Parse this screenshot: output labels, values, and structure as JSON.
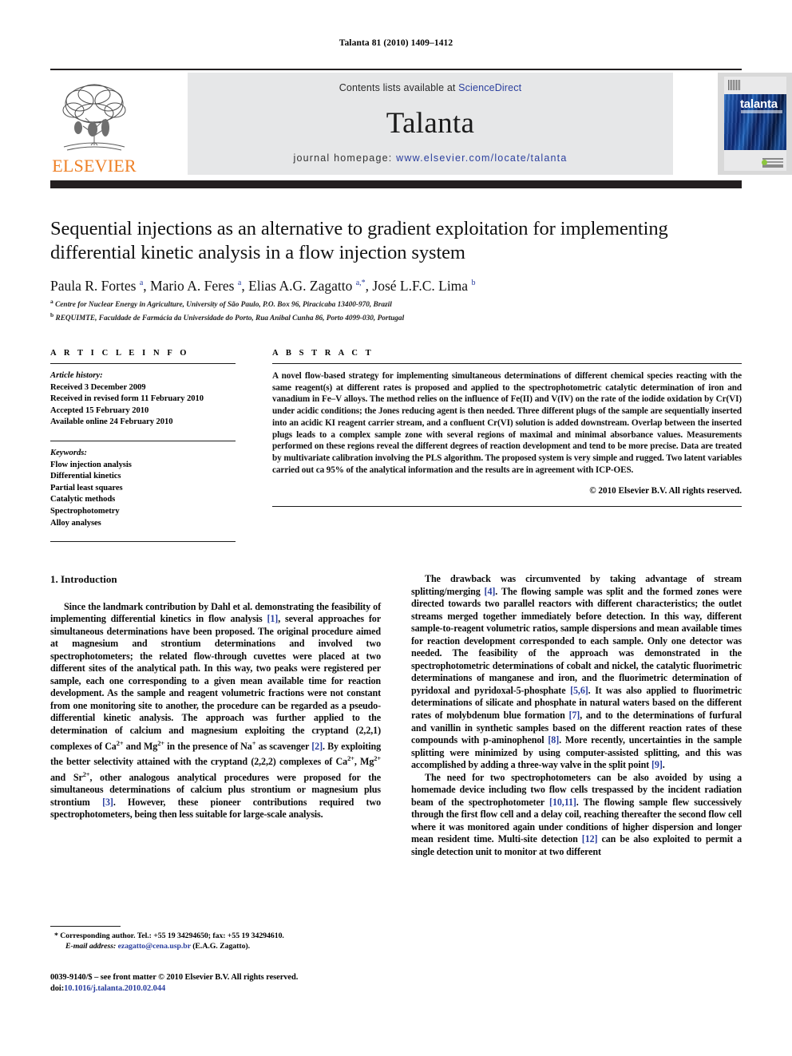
{
  "running_head": "Talanta 81 (2010) 1409–1412",
  "masthead": {
    "contents_prefix": "Contents lists available at ",
    "sciencedirect": "ScienceDirect",
    "journal_name": "Talanta",
    "homepage_prefix": "journal homepage:",
    "homepage_url": "www.elsevier.com/locate/talanta",
    "publisher_logo_text": "ELSEVIER",
    "cover_title": "talanta",
    "accent_orange": "#ee7f25",
    "link_blue": "#2b3f9e",
    "band_gray": "#e6e7e8",
    "rule_dark": "#231f20"
  },
  "article": {
    "title": "Sequential injections as an alternative to gradient exploitation for implementing differential kinetic analysis in a flow injection system",
    "authors_html": "Paula R. Fortes <sup>a</sup>, Mario A. Feres <sup>a</sup>, Elias A.G. Zagatto <sup>a,*</sup>, José L.F.C. Lima <sup>b</sup>",
    "affiliation_a": "Centre for Nuclear Energy in Agriculture, University of São Paulo, P.O. Box 96, Piracicaba 13400-970, Brazil",
    "affiliation_b": "REQUIMTE, Faculdade de Farmácia da Universidade do Porto, Rua Anibal Cunha 86, Porto 4099-030, Portugal"
  },
  "info": {
    "heading": "A R T I C L E   I N F O",
    "history_label": "Article history:",
    "history": [
      "Received 3 December 2009",
      "Received in revised form 11 February 2010",
      "Accepted 15 February 2010",
      "Available online 24 February 2010"
    ],
    "keywords_label": "Keywords:",
    "keywords": [
      "Flow injection analysis",
      "Differential kinetics",
      "Partial least squares",
      "Catalytic methods",
      "Spectrophotometry",
      "Alloy analyses"
    ]
  },
  "abstract": {
    "heading": "A B S T R A C T",
    "text": "A novel flow-based strategy for implementing simultaneous determinations of different chemical species reacting with the same reagent(s) at different rates is proposed and applied to the spectrophotometric catalytic determination of iron and vanadium in Fe–V alloys. The method relies on the influence of Fe(II) and V(IV) on the rate of the iodide oxidation by Cr(VI) under acidic conditions; the Jones reducing agent is then needed. Three different plugs of the sample are sequentially inserted into an acidic KI reagent carrier stream, and a confluent Cr(VI) solution is added downstream. Overlap between the inserted plugs leads to a complex sample zone with several regions of maximal and minimal absorbance values. Measurements performed on these regions reveal the different degrees of reaction development and tend to be more precise. Data are treated by multivariate calibration involving the PLS algorithm. The proposed system is very simple and rugged. Two latent variables carried out ca 95% of the analytical information and the results are in agreement with ICP-OES.",
    "copyright": "© 2010 Elsevier B.V. All rights reserved."
  },
  "body": {
    "section_heading": "1.  Introduction",
    "left_paragraphs_html": [
      "Since the landmark contribution by Dahl et al. demonstrating the feasibility of implementing differential kinetics in flow analysis <span class=\"ref\">[1]</span>, several approaches for simultaneous determinations have been proposed. The original procedure aimed at magnesium and strontium determinations and involved two spectrophotometers; the related flow-through cuvettes were placed at two different sites of the analytical path. In this way, two peaks were registered per sample, each one corresponding to a given mean available time for reaction development. As the sample and reagent volumetric fractions were not constant from one monitoring site to another, the procedure can be regarded as a pseudo-differential kinetic analysis. The approach was further applied to the determination of calcium and magnesium exploiting the cryptand (2,2,1) complexes of Ca<sup class=\"chg\">2+</sup> and Mg<sup class=\"chg\">2+</sup> in the presence of Na<sup class=\"chg\">+</sup> as scavenger <span class=\"ref\">[2]</span>. By exploiting the better selectivity attained with the cryptand (2,2,2) complexes of Ca<sup class=\"chg\">2+</sup>, Mg<sup class=\"chg\">2+</sup> and Sr<sup class=\"chg\">2+</sup>, other analogous analytical procedures were proposed for the simultaneous determinations of calcium plus strontium or magnesium plus strontium <span class=\"ref\">[3]</span>. However, these pioneer contributions required two spectrophotometers, being then less suitable for large-scale analysis."
    ],
    "right_paragraphs_html": [
      "The drawback was circumvented by taking advantage of stream splitting/merging <span class=\"ref\">[4]</span>. The flowing sample was split and the formed zones were directed towards two parallel reactors with different characteristics; the outlet streams merged together immediately before detection. In this way, different sample-to-reagent volumetric ratios, sample dispersions and mean available times for reaction development corresponded to each sample. Only one detector was needed. The feasibility of the approach was demonstrated in the spectrophotometric determinations of cobalt and nickel, the catalytic fluorimetric determinations of manganese and iron, and the fluorimetric determination of pyridoxal and pyridoxal-5-phosphate <span class=\"ref\">[5,6]</span>. It was also applied to fluorimetric determinations of silicate and phosphate in natural waters based on the different rates of molybdenum blue formation <span class=\"ref\">[7]</span>, and to the determinations of furfural and vanillin in synthetic samples based on the different reaction rates of these compounds with p-aminophenol <span class=\"ref\">[8]</span>. More recently, uncertainties in the sample splitting were minimized by using computer-assisted splitting, and this was accomplished by adding a three-way valve in the split point <span class=\"ref\">[9]</span>.",
      "The need for two spectrophotometers can be also avoided by using a homemade device including two flow cells trespassed by the incident radiation beam of the spectrophotometer <span class=\"ref\">[10,11]</span>. The flowing sample flew successively through the first flow cell and a delay coil, reaching thereafter the second flow cell where it was monitored again under conditions of higher dispersion and longer mean resident time. Multi-site detection <span class=\"ref\">[12]</span> can be also exploited to permit a single detection unit to monitor at two different"
    ]
  },
  "footnotes": {
    "corresponding_html": "* Corresponding author. Tel.: +55 19 34294650; fax: +55 19 34294610.",
    "email_label": "E-mail address:",
    "email": "ezagatto@cena.usp.br",
    "email_owner": "(E.A.G. Zagatto).",
    "imprint": "0039-9140/$ – see front matter © 2010 Elsevier B.V. All rights reserved.",
    "doi_label": "doi:",
    "doi_value": "10.1016/j.talanta.2010.02.044"
  }
}
